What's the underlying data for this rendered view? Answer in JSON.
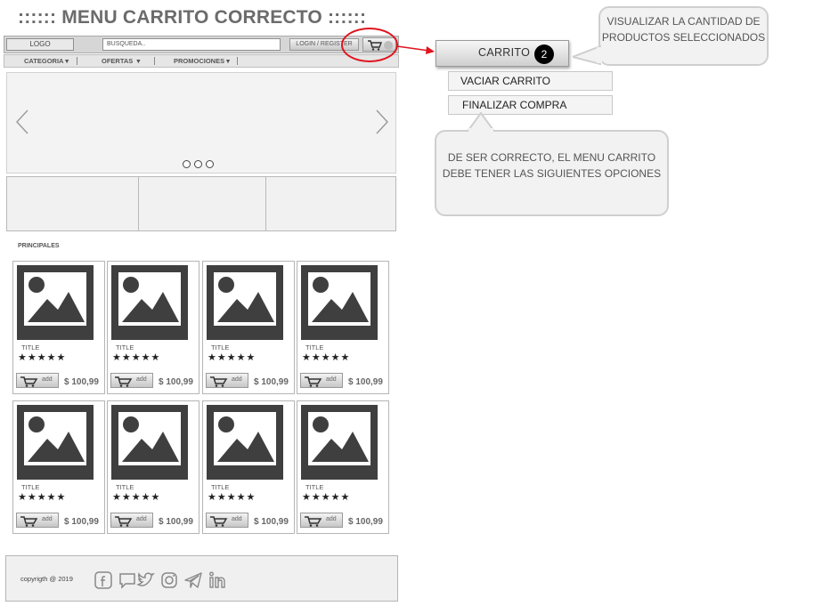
{
  "page": {
    "title": ":::::: MENU CARRITO CORRECTO ::::::"
  },
  "header": {
    "logo": "LOGO",
    "search_placeholder": "BUSQUEDA..",
    "login": "LOGIN / REGISTER"
  },
  "nav": {
    "items": [
      "CATEGORIA",
      "OFERTAS",
      "PROMOCIONES"
    ]
  },
  "section": {
    "title": "PRINCIPALES"
  },
  "products": [
    {
      "title": "TITLE",
      "stars": "★★★★★",
      "add": "add",
      "price": "$ 100,99"
    },
    {
      "title": "TITLE",
      "stars": "★★★★★",
      "add": "add",
      "price": "$ 100,99"
    },
    {
      "title": "TITLE",
      "stars": "★★★★★",
      "add": "add",
      "price": "$ 100,99"
    },
    {
      "title": "TITLE",
      "stars": "★★★★★",
      "add": "add",
      "price": "$ 100,99"
    },
    {
      "title": "TITLE",
      "stars": "★★★★★",
      "add": "add",
      "price": "$ 100,99"
    },
    {
      "title": "TITLE",
      "stars": "★★★★★",
      "add": "add",
      "price": "$ 100,99"
    },
    {
      "title": "TITLE",
      "stars": "★★★★★",
      "add": "add",
      "price": "$ 100,99"
    },
    {
      "title": "TITLE",
      "stars": "★★★★★",
      "add": "add",
      "price": "$ 100,99"
    }
  ],
  "footer": {
    "copyright": "copyrigth @ 2019",
    "social_icons": [
      "facebook-icon",
      "chat-icon",
      "twitter-icon",
      "instagram-icon",
      "telegram-icon",
      "linkedin-icon"
    ]
  },
  "cart_menu": {
    "label": "CARRITO",
    "count": "2",
    "options": [
      "VACIAR CARRITO",
      "FINALIZAR COMPRA"
    ]
  },
  "notes": {
    "quantity": "VISUALIZAR LA CANTIDAD DE PRODUCTOS SELECCIONADOS",
    "options": "DE SER CORRECTO, EL MENU CARRITO DEBE TENER  LAS SIGUIENTES OPCIONES"
  },
  "colors": {
    "highlight": "#e0141e",
    "image_placeholder": "#3f3f3f",
    "badge": "#000000"
  }
}
